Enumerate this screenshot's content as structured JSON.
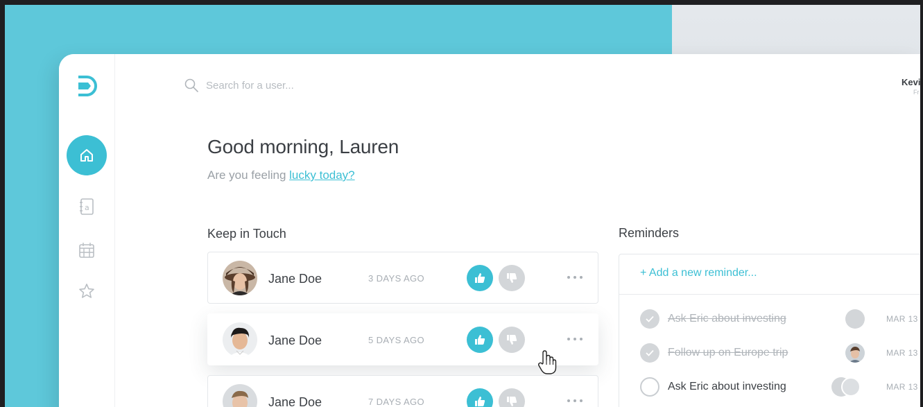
{
  "search": {
    "placeholder": "Search for a user..."
  },
  "user": {
    "name": "Kevi",
    "subtitle": "Fr"
  },
  "greeting": {
    "title": "Good morning, Lauren",
    "prefix": "Are you feeling ",
    "link": "lucky today?"
  },
  "keep_in_touch": {
    "title": "Keep in Touch",
    "rows": [
      {
        "name": "Jane Doe",
        "time": "3 DAYS AGO"
      },
      {
        "name": "Jane Doe",
        "time": "5 DAYS AGO"
      },
      {
        "name": "Jane Doe",
        "time": "7 DAYS AGO"
      }
    ]
  },
  "reminders": {
    "title": "Reminders",
    "add_label": "+  Add a new reminder...",
    "items": [
      {
        "text": "Ask Eric about investing",
        "date": "MAR 13",
        "done": true
      },
      {
        "text": "Follow up on Europe trip",
        "date": "MAR 13",
        "done": true
      },
      {
        "text": "Ask Eric about investing",
        "date": "MAR 13",
        "done": false
      }
    ]
  },
  "colors": {
    "accent": "#3cbfd4",
    "backdrop": "#5ec8da",
    "muted": "#d3d6d9"
  },
  "icons": [
    "logo-icon",
    "home-icon",
    "contacts-icon",
    "calendar-icon",
    "star-icon",
    "search-icon",
    "thumbs-up-icon",
    "thumbs-down-icon",
    "more-icon",
    "check-icon",
    "hand-cursor-icon"
  ]
}
